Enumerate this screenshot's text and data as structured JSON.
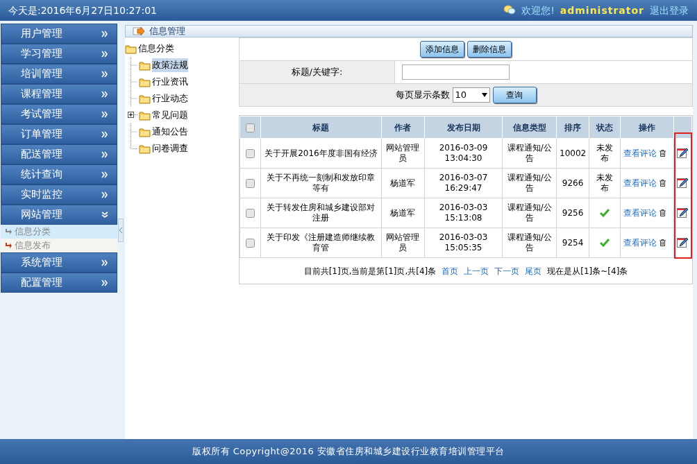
{
  "header": {
    "date_text": "今天是:2016年6月27日10:27:01",
    "welcome": "欢迎您!",
    "username": "administrator",
    "logout": "退出登录"
  },
  "sidebar": {
    "items": [
      {
        "label": "用户管理",
        "expanded": false
      },
      {
        "label": "学习管理",
        "expanded": false
      },
      {
        "label": "培训管理",
        "expanded": false
      },
      {
        "label": "课程管理",
        "expanded": false
      },
      {
        "label": "考试管理",
        "expanded": false
      },
      {
        "label": "订单管理",
        "expanded": false
      },
      {
        "label": "配送管理",
        "expanded": false
      },
      {
        "label": "统计查询",
        "expanded": false
      },
      {
        "label": "实时监控",
        "expanded": false
      },
      {
        "label": "网站管理",
        "expanded": true,
        "children": [
          {
            "label": "信息分类",
            "selected": true
          },
          {
            "label": "信息发布",
            "selected": false
          }
        ]
      },
      {
        "label": "系统管理",
        "expanded": false
      },
      {
        "label": "配置管理",
        "expanded": false
      }
    ]
  },
  "panel_title": "信息管理",
  "tree": {
    "label": "信息分类",
    "children": [
      {
        "label": "政策法规",
        "selected": true,
        "has_children": false
      },
      {
        "label": "行业资讯",
        "selected": false,
        "has_children": false
      },
      {
        "label": "行业动态",
        "selected": false,
        "has_children": false
      },
      {
        "label": "常见问题",
        "selected": false,
        "has_children": true
      },
      {
        "label": "通知公告",
        "selected": false,
        "has_children": false
      },
      {
        "label": "问卷调查",
        "selected": false,
        "has_children": false
      }
    ]
  },
  "toolbar": {
    "buttons": [
      "添加信息",
      "删除信息"
    ],
    "keyword_label": "标题/关键字:",
    "page_size_label": "每页显示条数",
    "page_size": "10",
    "query_button": "查询"
  },
  "table": {
    "columns": [
      "标题",
      "作者",
      "发布日期",
      "信息类型",
      "排序",
      "状态",
      "操作"
    ],
    "select_all_checked": false,
    "rows": [
      {
        "checked": false,
        "title": "关于开展2016年度非国有经济",
        "author": "网站管理员",
        "date": "2016-03-09 13:04:30",
        "type": "课程通知/公告",
        "order": "10002",
        "published": false,
        "status_text": "未发布",
        "action": "查看评论"
      },
      {
        "checked": false,
        "title": "关于不再统一刻制和发放印章等有",
        "author": "杨道军",
        "date": "2016-03-07 16:29:47",
        "type": "课程通知/公告",
        "order": "9266",
        "published": false,
        "status_text": "未发布",
        "action": "查看评论"
      },
      {
        "checked": false,
        "title": "关于转发住房和城乡建设部对注册",
        "author": "杨道军",
        "date": "2016-03-03 15:13:08",
        "type": "课程通知/公告",
        "order": "9256",
        "published": true,
        "action": "查看评论"
      },
      {
        "checked": false,
        "title": "关于印发《注册建造师继续教育管",
        "author": "网站管理员",
        "date": "2016-03-03 15:05:35",
        "type": "课程通知/公告",
        "order": "9254",
        "published": true,
        "action": "查看评论"
      }
    ],
    "highlight_edit_column": true
  },
  "pagination": {
    "summary": "目前共[1]页,当前是第[1]页,共[4]条",
    "links": [
      "首页",
      "上一页",
      "下一页",
      "尾页"
    ],
    "range": "现在是从[1]条~[4]条"
  },
  "footer": "版权所有 Copyright@2016 安徽省住房和城乡建设行业教育培训管理平台"
}
